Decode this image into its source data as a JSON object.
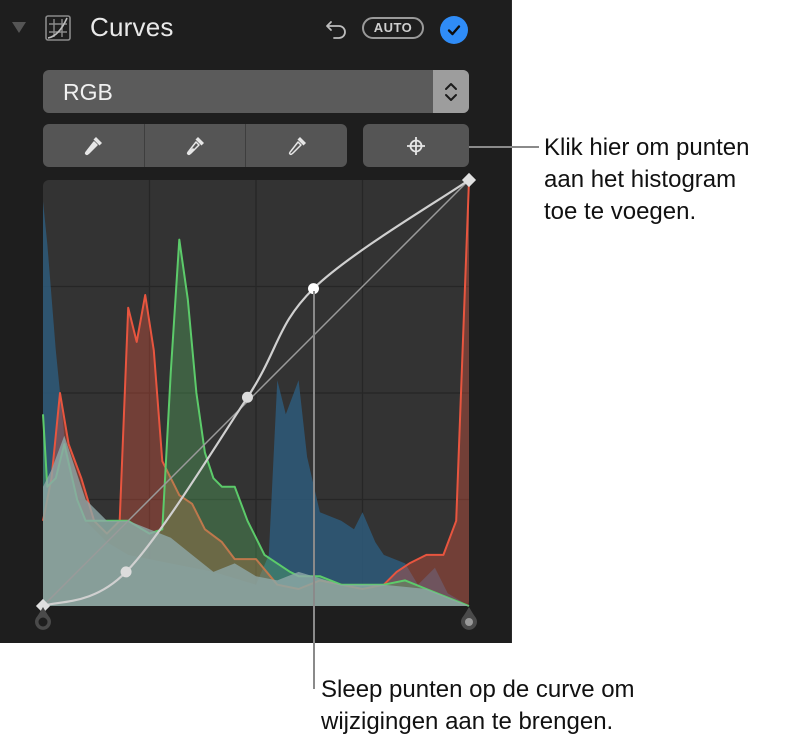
{
  "panel": {
    "title": "Curves",
    "auto_label": "AUTO",
    "icons": {
      "disclosure": "disclosure-triangle-down",
      "section": "curves-grid-icon",
      "undo": "undo-arrow-icon",
      "enabled": "checkmark-circle-icon"
    },
    "enabled": true,
    "accent_color": "#2f8cf7",
    "channel_select": {
      "value": "RGB",
      "icon": "up-down-chevron-icon"
    },
    "tools": [
      {
        "name": "black-point-eyedropper",
        "icon": "eyedropper-filled"
      },
      {
        "name": "gray-point-eyedropper",
        "icon": "eyedropper-half"
      },
      {
        "name": "white-point-eyedropper",
        "icon": "eyedropper-outline"
      },
      {
        "name": "add-points-target",
        "icon": "crosshair-icon"
      }
    ]
  },
  "chart_data": {
    "type": "area",
    "title": "Curves histogram",
    "xlabel": "",
    "ylabel": "",
    "xlim": [
      0,
      1
    ],
    "ylim": [
      0,
      1
    ],
    "grid": "4x4",
    "colors": {
      "red": "#e8553f",
      "green": "#5ccb6a",
      "blue": "#2e5a7a",
      "luminance": "#8fa8a8"
    },
    "curve_points": [
      [
        0,
        0
      ],
      [
        0.195,
        0.08
      ],
      [
        0.48,
        0.49
      ],
      [
        0.635,
        0.745
      ],
      [
        1,
        1
      ]
    ],
    "baseline_diagonal": [
      [
        0,
        0
      ],
      [
        1,
        1
      ]
    ],
    "series": [
      {
        "name": "Blue",
        "x": [
          0,
          0.01,
          0.03,
          0.05,
          0.08,
          0.1,
          0.15,
          0.2,
          0.3,
          0.4,
          0.5,
          0.53,
          0.55,
          0.57,
          0.6,
          0.62,
          0.65,
          0.7,
          0.73,
          0.75,
          0.78,
          0.8,
          0.85,
          0.88,
          0.92,
          0.95,
          1.0
        ],
        "y": [
          0.95,
          0.85,
          0.6,
          0.4,
          0.25,
          0.2,
          0.15,
          0.12,
          0.1,
          0.08,
          0.05,
          0.12,
          0.53,
          0.45,
          0.53,
          0.35,
          0.22,
          0.2,
          0.18,
          0.22,
          0.15,
          0.12,
          0.1,
          0.05,
          0.09,
          0.03,
          0.0
        ]
      },
      {
        "name": "Red",
        "x": [
          0,
          0.02,
          0.04,
          0.06,
          0.09,
          0.12,
          0.15,
          0.18,
          0.2,
          0.22,
          0.24,
          0.26,
          0.28,
          0.3,
          0.32,
          0.35,
          0.38,
          0.42,
          0.45,
          0.5,
          0.55,
          0.6,
          0.65,
          0.7,
          0.75,
          0.8,
          0.83,
          0.86,
          0.9,
          0.94,
          0.97,
          0.985,
          1.0
        ],
        "y": [
          0.2,
          0.3,
          0.5,
          0.38,
          0.3,
          0.2,
          0.17,
          0.2,
          0.7,
          0.62,
          0.73,
          0.6,
          0.34,
          0.3,
          0.26,
          0.24,
          0.18,
          0.15,
          0.11,
          0.11,
          0.05,
          0.04,
          0.06,
          0.05,
          0.04,
          0.05,
          0.08,
          0.1,
          0.12,
          0.12,
          0.2,
          0.6,
          1.0
        ]
      },
      {
        "name": "Green",
        "x": [
          0,
          0.01,
          0.03,
          0.05,
          0.08,
          0.1,
          0.12,
          0.15,
          0.2,
          0.25,
          0.28,
          0.3,
          0.32,
          0.34,
          0.36,
          0.38,
          0.4,
          0.42,
          0.45,
          0.48,
          0.5,
          0.52,
          0.55,
          0.58,
          0.6,
          0.65,
          0.7,
          0.75,
          0.8,
          0.85,
          0.9,
          0.95,
          1.0
        ],
        "y": [
          0.45,
          0.28,
          0.3,
          0.38,
          0.25,
          0.2,
          0.2,
          0.2,
          0.2,
          0.17,
          0.18,
          0.55,
          0.86,
          0.72,
          0.5,
          0.36,
          0.3,
          0.28,
          0.28,
          0.2,
          0.16,
          0.12,
          0.1,
          0.08,
          0.07,
          0.07,
          0.05,
          0.05,
          0.05,
          0.06,
          0.04,
          0.02,
          0.0
        ]
      },
      {
        "name": "Luminance",
        "x": [
          0,
          0.02,
          0.05,
          0.1,
          0.15,
          0.2,
          0.25,
          0.3,
          0.35,
          0.4,
          0.45,
          0.5,
          0.55,
          0.6,
          0.7,
          0.8,
          0.9,
          0.95,
          1.0
        ],
        "y": [
          0.28,
          0.32,
          0.4,
          0.25,
          0.2,
          0.2,
          0.18,
          0.16,
          0.12,
          0.08,
          0.1,
          0.07,
          0.06,
          0.08,
          0.05,
          0.05,
          0.04,
          0.02,
          0.0
        ]
      }
    ]
  },
  "callouts": [
    {
      "text": "Klik hier om punten\naan het histogram\ntoe te voegen."
    },
    {
      "text": "Sleep punten op de curve om\nwijzigingen aan te brengen."
    }
  ]
}
